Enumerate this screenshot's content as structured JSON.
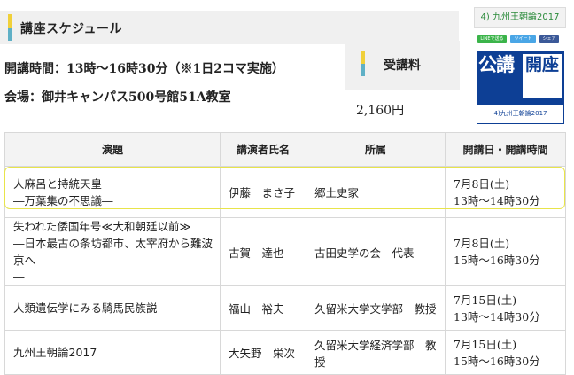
{
  "schedule_heading": "講座スケジュール",
  "hours": "開講時間：13時～16時30分（※1日2コマ実施）",
  "venue": "会場：御井キャンパス500号館51A教室",
  "fee_heading": "受講料",
  "fee_amount": "2,160円",
  "sidebar": {
    "title": "4) 九州王朝論2017",
    "share_line": "LINEで送る",
    "share_tweet": "ツイート",
    "share_fb": "シェア",
    "banner_logo_a": "公講",
    "banner_logo_b": "開座",
    "banner_caption": "4)九州王朝論2017"
  },
  "table": {
    "headers": [
      "演題",
      "講演者氏名",
      "所属",
      "開講日・開講時間"
    ],
    "rows": [
      {
        "title_1": "人麻呂と持統天皇",
        "title_2": "―万葉集の不思議―",
        "speaker": "伊藤　まさ子",
        "affiliation": "郷土史家",
        "date": "7月8日(土)",
        "time": "13時～14時30分"
      },
      {
        "title_1": "失われた倭国年号≪大和朝廷以前≫",
        "title_2": "―日本最古の条坊都市、太宰府から難波京へ",
        "title_3": "―",
        "speaker": "古賀　達也",
        "affiliation": "古田史学の会　代表",
        "date": "7月8日(土)",
        "time": "15時～16時30分"
      },
      {
        "title_1": "人類遺伝学にみる騎馬民族説",
        "speaker": "福山　裕夫",
        "affiliation": "久留米大学文学部　教授",
        "date": "7月15日(土)",
        "time": "13時～14時30分"
      },
      {
        "title_1": "九州王朝論2017",
        "speaker": "大矢野　栄次",
        "affiliation": "久留米大学経済学部　教授",
        "date": "7月15日(土)",
        "time": "15時～16時30分"
      }
    ]
  },
  "colors": {
    "accent_yellow": "#f0d03a",
    "accent_teal": "#5fb0c6",
    "banner_blue": "#0d3f95"
  }
}
